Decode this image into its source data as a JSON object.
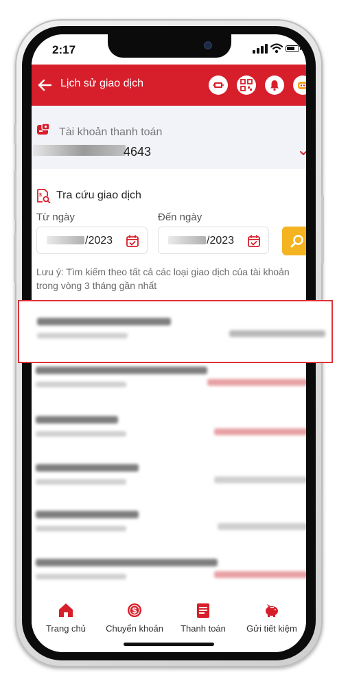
{
  "status_bar": {
    "time": "2:17",
    "battery_level": 0.8
  },
  "header": {
    "title": "Lịch sử giao dịch",
    "action_icons": [
      "scan-card-icon",
      "qr-code-icon",
      "bell-icon",
      "robot-icon"
    ]
  },
  "account": {
    "label": "Tài khoản thanh toán",
    "number_suffix": "4643"
  },
  "lookup": {
    "title": "Tra cứu giao dịch",
    "from_label": "Từ ngày",
    "from_value": "/2023",
    "to_label": "Đến ngày",
    "to_value": "/2023",
    "note": "Lưu ý: Tìm kiếm theo tất cả các loại giao dịch của tài khoản trong vòng 3 tháng gần nhất"
  },
  "transactions": [
    {
      "highlighted": true,
      "amount_type": "debit"
    },
    {
      "highlighted": false,
      "amount_type": "credit"
    },
    {
      "highlighted": false,
      "amount_type": "credit"
    },
    {
      "highlighted": false,
      "amount_type": "debit"
    },
    {
      "highlighted": false,
      "amount_type": "debit"
    },
    {
      "highlighted": false,
      "amount_type": "credit"
    }
  ],
  "bottom_nav": [
    {
      "label": "Trang chủ",
      "icon": "home-icon"
    },
    {
      "label": "Chuyển khoản",
      "icon": "coin-transfer-icon"
    },
    {
      "label": "Thanh toán",
      "icon": "bill-icon"
    },
    {
      "label": "Gửi tiết kiệm",
      "icon": "piggy-bank-icon"
    }
  ],
  "colors": {
    "brand_red": "#d71f2b",
    "search_yellow": "#f4b320",
    "credit_red": "#e8a0a3",
    "debit_gray": "#cfcfcf",
    "highlight_border": "#e03137"
  }
}
